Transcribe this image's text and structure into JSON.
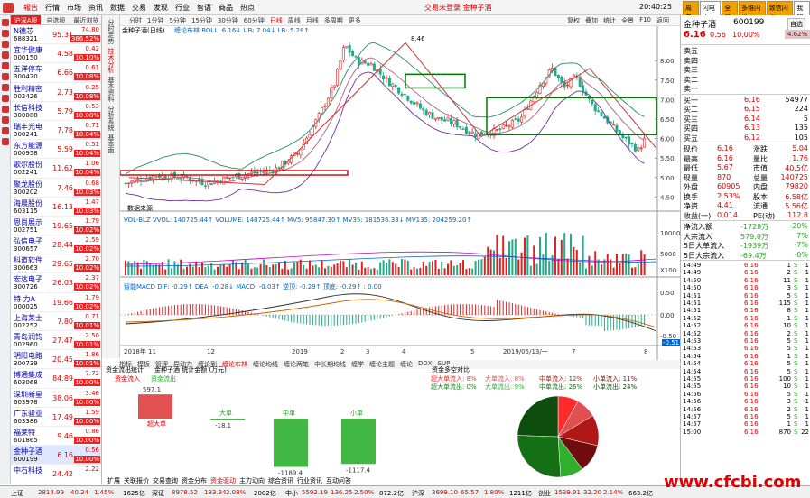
{
  "topbar": {
    "menu": [
      "報告",
      "行情",
      "市场",
      "资讯",
      "数据",
      "交易",
      "发现",
      "行业",
      "智语",
      "商品",
      "热点"
    ],
    "center_text": "交易未登录   金种子酒",
    "clock": "20:40:25",
    "tabs": [
      "周五",
      "闪电手",
      "全景",
      "多维闪讯",
      "致信闪讯",
      "我的"
    ]
  },
  "toolbar": {
    "left": [
      "分时",
      "1分钟",
      "5分钟",
      "15分钟",
      "30分钟",
      "60分钟",
      "日线",
      "周线",
      "月线",
      "多周期",
      "更多"
    ],
    "right": [
      "复权",
      "叠加",
      "统计",
      "全景",
      "F10",
      "返回"
    ]
  },
  "leftlist": {
    "tabs": [
      "沪深A股",
      "自选股",
      "最近浏览"
    ],
    "rows": [
      {
        "name": "N德芯",
        "code": "688321",
        "price": "95.31",
        "chg": "74.80",
        "pct": "366.52%"
      },
      {
        "name": "宜华健康",
        "code": "000150",
        "price": "4.58",
        "chg": "0.42",
        "pct": "10.10%"
      },
      {
        "name": "五洋停车",
        "code": "300420",
        "price": "6.66",
        "chg": "0.61",
        "pct": "10.08%"
      },
      {
        "name": "胜利精密",
        "code": "002426",
        "price": "2.73",
        "price2": "",
        "chg": "0.25",
        "pct": "10.08%"
      },
      {
        "name": "长信科技",
        "code": "300088",
        "price": "5.79",
        "chg": "0.53",
        "pct": "10.08%"
      },
      {
        "name": "瑞丰光电",
        "code": "300241",
        "price": "7.78",
        "chg": "0.71",
        "pct": "10.04%"
      },
      {
        "name": "东方能源",
        "code": "000958",
        "price": "5.59",
        "chg": "0.51",
        "pct": "10.04%"
      },
      {
        "name": "歌尔股份",
        "code": "002241",
        "price": "11.62",
        "chg": "1.06",
        "pct": "10.04%"
      },
      {
        "name": "聚龙股份",
        "code": "300202",
        "price": "7.46",
        "chg": "0.68",
        "pct": "10.03%"
      },
      {
        "name": "海晨股份",
        "code": "603115",
        "price": "16.13",
        "chg": "1.47",
        "pct": "10.03%"
      },
      {
        "name": "恩尚展示",
        "code": "002751",
        "price": "19.65",
        "chg": "1.79",
        "pct": "10.02%"
      },
      {
        "name": "弘信电子",
        "code": "300657",
        "price": "28.44",
        "chg": "2.59",
        "pct": "10.02%"
      },
      {
        "name": "科道软件",
        "code": "300663",
        "price": "29.65",
        "chg": "2.70",
        "pct": "10.02%"
      },
      {
        "name": "宏达电子",
        "code": "300726",
        "price": "26.03",
        "chg": "2.37",
        "pct": "10.02%"
      },
      {
        "name": "特 力A",
        "code": "000025",
        "price": "19.66",
        "chg": "1.79",
        "pct": "10.02%"
      },
      {
        "name": "上海莱士",
        "code": "002252",
        "price": "7.80",
        "chg": "0.71",
        "pct": "10.01%"
      },
      {
        "name": "青岛润钧",
        "code": "002960",
        "price": "27.47",
        "chg": "2.50",
        "pct": "10.01%"
      },
      {
        "name": "明阳电路",
        "code": "300739",
        "price": "20.45",
        "chg": "1.86",
        "pct": "10.01%"
      },
      {
        "name": "博通集成",
        "code": "603068",
        "price": "84.89",
        "chg": "7.72",
        "pct": "10.00%"
      },
      {
        "name": "深圳新星",
        "code": "603978",
        "price": "38.06",
        "chg": "3.46",
        "pct": "10.00%"
      },
      {
        "name": "广东骏亚",
        "code": "603386",
        "price": "17.49",
        "chg": "1.59",
        "pct": "10.00%"
      },
      {
        "name": "福莱特",
        "code": "601865",
        "price": "9.46",
        "chg": "0.86",
        "pct": "10.00%"
      },
      {
        "name": "金种子酒",
        "code": "600199",
        "price": "6.16",
        "chg": "0.56",
        "pct": "10.00%"
      },
      {
        "name": "中石科技",
        "code": "",
        "price": "24.42",
        "chg": "2.22",
        "pct": ""
      }
    ]
  },
  "sidev": [
    "分时走势",
    "技术分析",
    "基本资料",
    "分析系统",
    "基本面"
  ],
  "chart": {
    "title": "金种子酒(日线)",
    "ma_legend": "缠论布林 BOLL: 6.16↓ UB: 7.04↓ LB: 5.28↑",
    "high_label": "8.46",
    "y_ticks": [
      "8.00",
      "7.50",
      "7.00",
      "6.50",
      "6.00",
      "5.50",
      "5.00",
      "4.50"
    ],
    "low_label": "数据来源",
    "vol_legend": "VOL-BLZ VVOL: 140725.44↑ VOLUME: 140725.44↑ MV5: 95847.30↑ MV35: 181536.33↓ MV135: 204259.20↑",
    "vol_ticks": [
      "10000",
      "5000",
      "X100"
    ],
    "macd_legend": "智能MACD DIF: -0.29↑ DEA: -0.28↓ MACD: -0.03↑ 逆顶: -0.29↑ 顶底: -0.29↑ : 0.00",
    "macd_ticks": [
      "0.50",
      "0.00",
      "-0.50"
    ],
    "macd_val": "-0.51",
    "x_labels": [
      "2018年 11",
      "12",
      "2019",
      "2",
      "3",
      "4",
      "5",
      "2019/05/13/一",
      "7",
      "8"
    ]
  },
  "tabs_under_chart": [
    "指标",
    "模板",
    "管理",
    "异动力",
    "缠论到",
    "缠论布林",
    "缠论均线",
    "缠论两笔",
    "中长期均线",
    "缠学",
    "缠论主题",
    "缠论",
    "DDX",
    "SUP"
  ],
  "fund_flow": {
    "title": "资金流出统计",
    "sub": "金种子酒  统计金额 (万元)",
    "legend": [
      "资金流入",
      "资金流出"
    ],
    "bars": [
      {
        "label": "超大单",
        "value": "597.1"
      },
      {
        "label": "大单",
        "value": "-18.1"
      },
      {
        "label": "中单",
        "value": "-1189.4"
      },
      {
        "label": "小单",
        "value": "-1117.4"
      }
    ]
  },
  "fund_pie": {
    "title": "资金多空对比",
    "legend": [
      "超大单流入: 8%",
      "大单流入: 8%",
      "中单流入: 12%",
      "小单流入: 11%",
      "超大单流出: 0%",
      "大单流出: 9%",
      "中单流出: 26%",
      "小单流出: 24%"
    ],
    "values": [
      8,
      8,
      12,
      11,
      0,
      9,
      26,
      24
    ],
    "colors": [
      "#ff2b2b",
      "#e05050",
      "#b01818",
      "#700e0e",
      "#1a8a1a",
      "#2eaf2e",
      "#157015",
      "#0d4d0d"
    ]
  },
  "right": {
    "name": "金种子酒",
    "code": "600199",
    "fav": "自选",
    "price": "6.16",
    "chg": "0.56",
    "pct": "10.00%",
    "box": "4.62%",
    "sells": [
      {
        "l": "卖五",
        "p": "",
        "v": ""
      },
      {
        "l": "卖四",
        "p": "",
        "v": ""
      },
      {
        "l": "卖三",
        "p": "",
        "v": ""
      },
      {
        "l": "卖二",
        "p": "",
        "v": ""
      },
      {
        "l": "卖一",
        "p": "",
        "v": ""
      }
    ],
    "buys": [
      {
        "l": "买一",
        "p": "6.16",
        "v": "54977"
      },
      {
        "l": "买二",
        "p": "6.15",
        "v": "224"
      },
      {
        "l": "买三",
        "p": "6.14",
        "v": "5"
      },
      {
        "l": "买四",
        "p": "6.13",
        "v": "135"
      },
      {
        "l": "买五",
        "p": "6.12",
        "v": "105"
      }
    ],
    "stats": [
      {
        "a": "现价",
        "b": "6.16",
        "c": "涨跌",
        "d": "5.04"
      },
      {
        "a": "最高",
        "b": "6.16",
        "c": "量比",
        "d": "1.76"
      },
      {
        "a": "最低",
        "b": "5.67",
        "c": "市值",
        "d": "40.5亿"
      },
      {
        "a": "现量",
        "b": "870",
        "c": "总量",
        "d": "140725"
      },
      {
        "a": "外盘",
        "b": "60905",
        "c": "内盘",
        "d": "79820"
      },
      {
        "a": "换手",
        "b": "2.53%",
        "c": "股本",
        "d": "6.58亿"
      },
      {
        "a": "净资",
        "b": "4.41",
        "c": "流通",
        "d": "5.56亿"
      },
      {
        "a": "收益(一)",
        "b": "0.014",
        "c": "PE(动)",
        "d": "112.8"
      }
    ],
    "flows": [
      {
        "a": "净流入额",
        "b": "-1728万",
        "c": "-20%"
      },
      {
        "a": "大宗流入",
        "b": "579.0万",
        "c": "7%"
      },
      {
        "a": "5日大单流入",
        "b": "-1939万",
        "c": "-7%"
      },
      {
        "a": "5日大宗流入",
        "b": "-69.4万",
        "c": "-0%"
      }
    ],
    "ticks": [
      [
        "14:49",
        "6.16",
        "1",
        "S",
        "1"
      ],
      [
        "14:49",
        "6.16",
        "2",
        "S",
        "1"
      ],
      [
        "14:50",
        "6.16",
        "11",
        "S",
        "1"
      ],
      [
        "14:50",
        "6.16",
        "3",
        "S",
        "1"
      ],
      [
        "14:51",
        "6.16",
        "5",
        "S",
        "1"
      ],
      [
        "14:51",
        "6.16",
        "115",
        "S",
        "1"
      ],
      [
        "14:51",
        "6.16",
        "8",
        "S",
        "1"
      ],
      [
        "14:52",
        "6.16",
        "1",
        "S",
        "1"
      ],
      [
        "14:52",
        "6.16",
        "10",
        "S",
        "1"
      ],
      [
        "14:52",
        "6.16",
        "2",
        "S",
        "1"
      ],
      [
        "14:53",
        "6.16",
        "5",
        "S",
        "1"
      ],
      [
        "14:53",
        "6.16",
        "5",
        "S",
        "1"
      ],
      [
        "14:54",
        "6.16",
        "1",
        "S",
        "1"
      ],
      [
        "14:54",
        "6.16",
        "5",
        "S",
        "1"
      ],
      [
        "14:54",
        "6.16",
        "5",
        "S",
        "1"
      ],
      [
        "14:55",
        "6.16",
        "100",
        "S",
        "1"
      ],
      [
        "14:55",
        "6.16",
        "10",
        "S",
        "1"
      ],
      [
        "14:56",
        "6.16",
        "5",
        "S",
        "1"
      ],
      [
        "14:56",
        "6.16",
        "3",
        "S",
        "1"
      ],
      [
        "14:56",
        "6.16",
        "2",
        "S",
        "1"
      ],
      [
        "14:57",
        "6.16",
        "5",
        "S",
        "1"
      ],
      [
        "14:57",
        "6.16",
        "1",
        "S",
        "1"
      ],
      [
        "15:00",
        "6.16",
        "870",
        "S",
        "22"
      ]
    ]
  },
  "bottom_tabs": [
    "扩展",
    "关联报价",
    "交易查询",
    "资金分布",
    "资金驱动",
    "主力动向",
    "综合资讯",
    "行业资讯",
    "互动问答"
  ],
  "taskbar": [
    "上证",
    "2814.99",
    "40.24",
    "1.45%",
    "1625亿",
    "深证",
    "8978.52",
    "183.34",
    "2.08%",
    "2002亿",
    "中小",
    "5592.19",
    "136.25",
    "2.50%",
    "872.2亿",
    "沪深",
    "3699.10",
    "65.57",
    "1.80%",
    "1211亿",
    "创业",
    "1539.91",
    "32.20",
    "2.14%",
    "663.2亿"
  ],
  "watermark": "www.cfcbi.com"
}
